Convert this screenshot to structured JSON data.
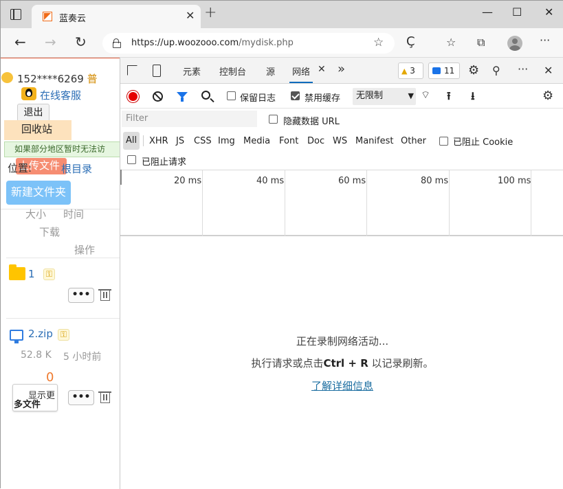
{
  "browser": {
    "tab_title": "蓝奏云",
    "tab_close": "✕",
    "new_tab": "+",
    "window_controls": {
      "minimize": "—",
      "maximize": "☐",
      "close": "✕"
    },
    "nav": {
      "back": "←",
      "forward": "→",
      "reload": "↻"
    },
    "url_host": "https://up.woozooo.com",
    "url_path": "/mydisk.php",
    "toolbar_icons": {
      "favorites_add": "☆",
      "collections": "⧉",
      "more": "···"
    }
  },
  "page": {
    "user": "152****6269",
    "vip": "普",
    "kefu": "在线客服",
    "logout": "退出",
    "recycle": "回收站",
    "notice": "如果部分地区暂时无法访",
    "position_label": "位置:",
    "upload": "上传文件",
    "root": "根目录",
    "new_folder": "新建文件夹",
    "headers": {
      "size": "大小",
      "time": "时间",
      "download": "下载",
      "action": "操作"
    },
    "files": [
      {
        "name": "1",
        "type": "folder"
      },
      {
        "name": "2.zip",
        "type": "zip",
        "size": "52.8 K",
        "time": "5 小时前",
        "downloads": "0"
      }
    ],
    "more_label": "•••",
    "show_more": "显示更",
    "more_files": "多文件"
  },
  "devtools": {
    "tabs": [
      "元素",
      "控制台",
      "源",
      "网络"
    ],
    "overflow": "»",
    "warnings": "3",
    "messages": "11",
    "preserve_log": "保留日志",
    "disable_cache": "禁用缓存",
    "throttle": "无限制",
    "filter_placeholder": "Filter",
    "hide_data_url": "隐藏数据 URL",
    "types": [
      "All",
      "XHR",
      "JS",
      "CSS",
      "Img",
      "Media",
      "Font",
      "Doc",
      "WS",
      "Manifest",
      "Other"
    ],
    "blocked_cookies": "已阻止 Cookie",
    "blocked_requests": "已阻止请求",
    "timeline_labels": [
      "20 ms",
      "40 ms",
      "60 ms",
      "80 ms",
      "100 ms"
    ],
    "empty_line1": "正在录制网络活动...",
    "empty_line2_pre": "执行请求或点击",
    "empty_line2_key": "Ctrl + R",
    "empty_line2_post": "以记录刷新。",
    "learn_more": "了解详细信息"
  }
}
